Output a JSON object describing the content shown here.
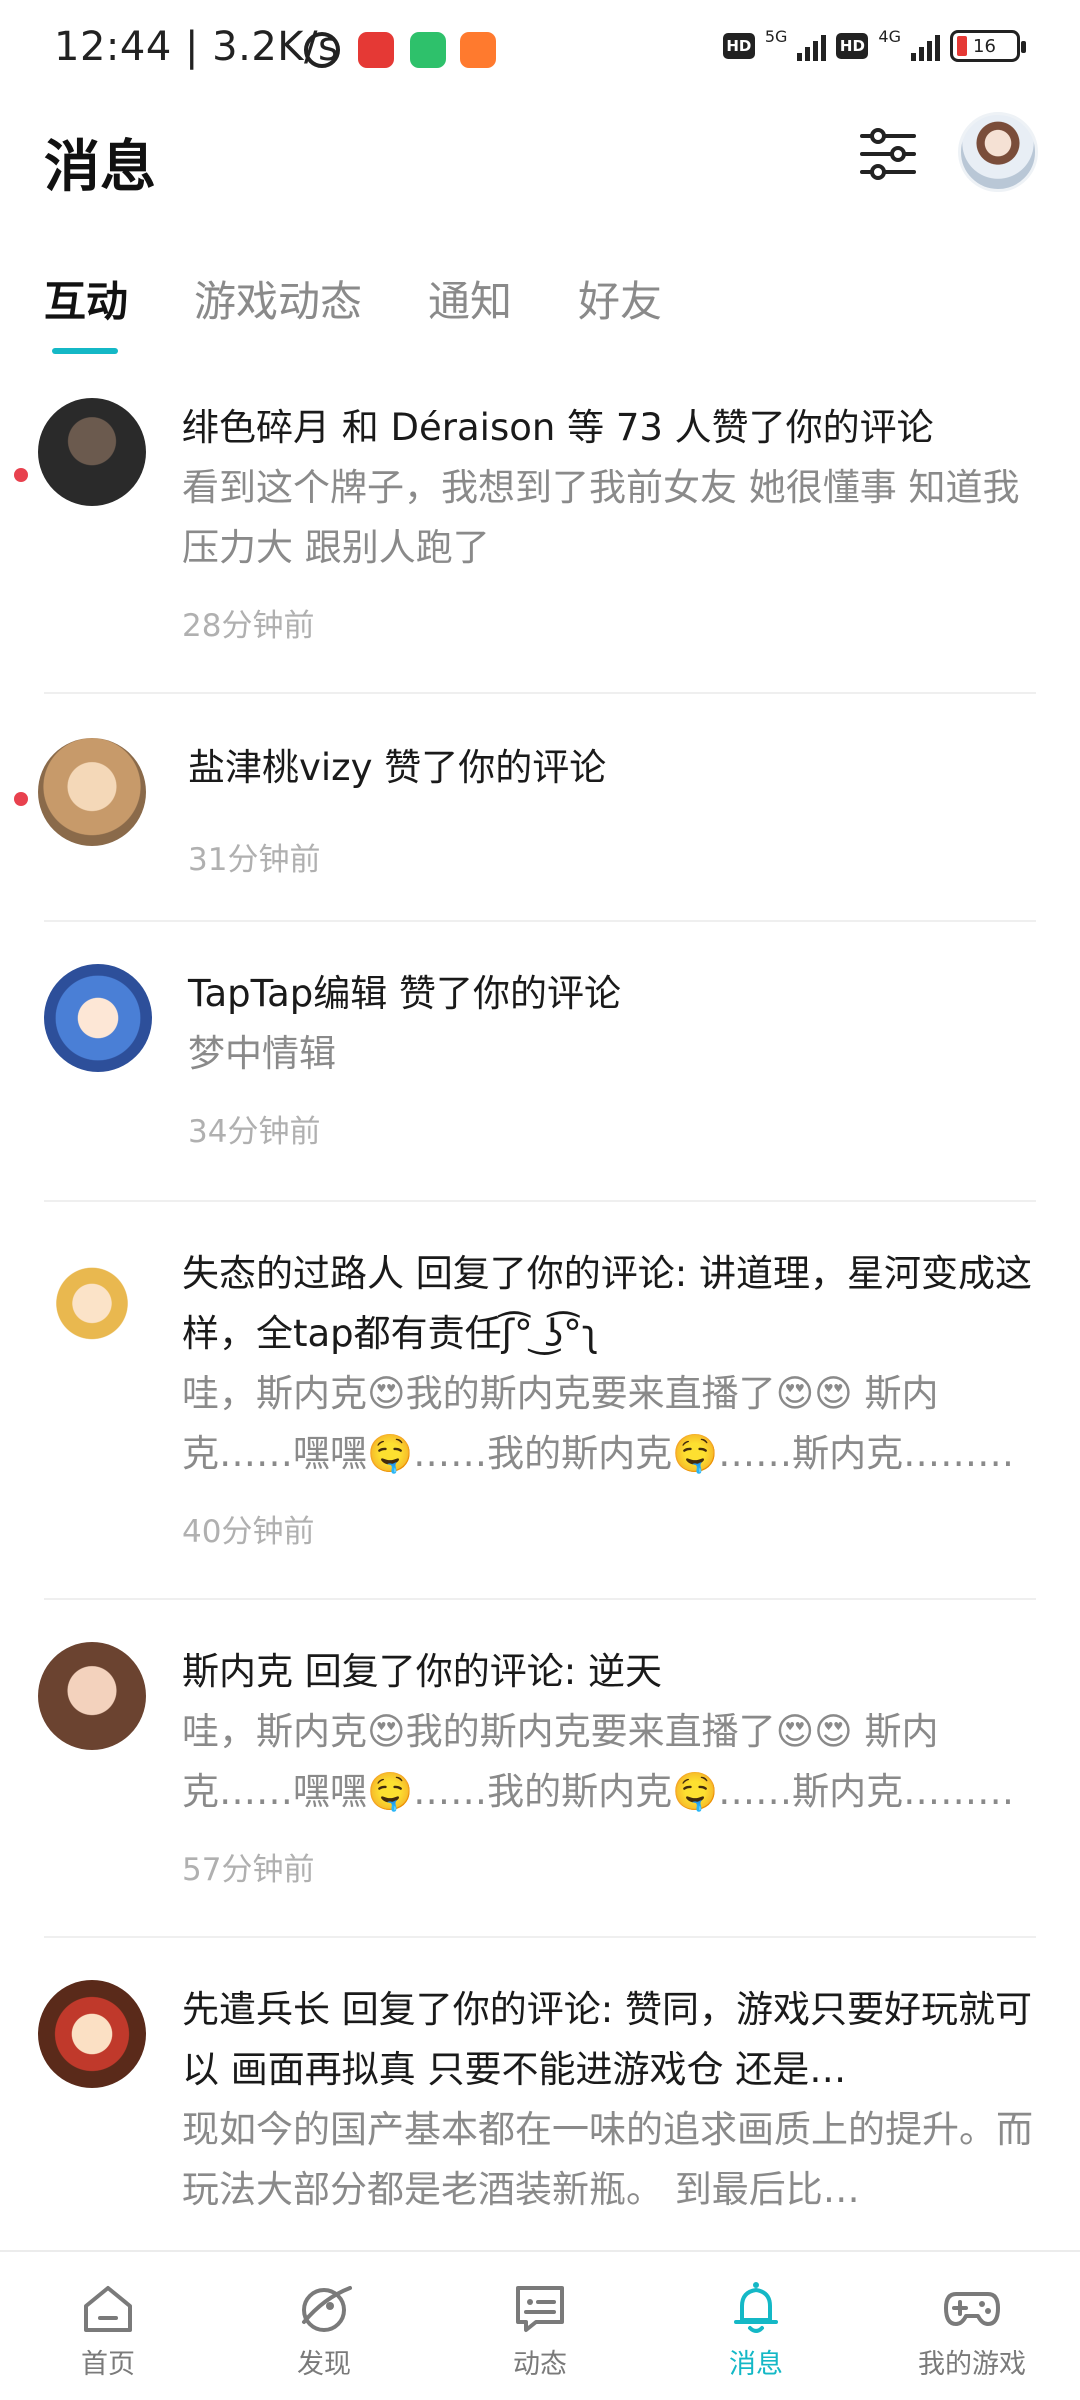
{
  "status_bar": {
    "time": "12:44 | 3.2K/s",
    "net1": "5G",
    "net2": "4G",
    "hd": "HD",
    "battery": "16"
  },
  "header": {
    "title": "消息"
  },
  "tabs": [
    {
      "label": "互动",
      "active": true
    },
    {
      "label": "游戏动态",
      "active": false
    },
    {
      "label": "通知",
      "active": false
    },
    {
      "label": "好友",
      "active": false
    }
  ],
  "messages": [
    {
      "unread": true,
      "title": "绯色碎月 和 Déraison 等 73 人赞了你的评论",
      "snippet": "看到这个牌子，我想到了我前女友 她很懂事 知道我压力大 跟别人跑了",
      "time": "28分钟前"
    },
    {
      "unread": true,
      "title": "盐津桃vizy 赞了你的评论",
      "snippet": "",
      "time": "31分钟前"
    },
    {
      "unread": false,
      "title": "TapTap编辑 赞了你的评论",
      "snippet": "梦中情辑",
      "time": "34分钟前"
    },
    {
      "unread": false,
      "title": "失态的过路人 回复了你的评论: 讲道理，星河变成这样，全tap都有责任ʃ͡° ͜ʖ͡°ʅ",
      "snippet": "哇，斯内克😍我的斯内克要来直播了😍😍 斯内克……嘿嘿🤤……我的斯内克🤤……斯内克……嘿嘿……",
      "time": "40分钟前"
    },
    {
      "unread": false,
      "title": "斯内克 回复了你的评论: 逆天",
      "snippet": "哇，斯内克😍我的斯内克要来直播了😍😍 斯内克……嘿嘿🤤……我的斯内克🤤……斯内克……嘿嘿……",
      "time": "57分钟前"
    },
    {
      "unread": false,
      "title": "先遣兵长 回复了你的评论: 赞同，游戏只要好玩就可以  画面再拟真  只要不能进游戏仓  还是…",
      "snippet": "现如今的国产基本都在一味的追求画质上的提升。而玩法大部分都是老酒装新瓶。 到最后比…",
      "time": ""
    }
  ],
  "bottom_nav": [
    {
      "label": "首页",
      "icon": "home-icon",
      "active": false
    },
    {
      "label": "发现",
      "icon": "discover-icon",
      "active": false
    },
    {
      "label": "动态",
      "icon": "moments-icon",
      "active": false
    },
    {
      "label": "消息",
      "icon": "bell-icon",
      "active": true
    },
    {
      "label": "我的游戏",
      "icon": "gamepad-icon",
      "active": false
    }
  ],
  "colors": {
    "accent": "#14b8c6",
    "unread_dot": "#e8414e"
  }
}
